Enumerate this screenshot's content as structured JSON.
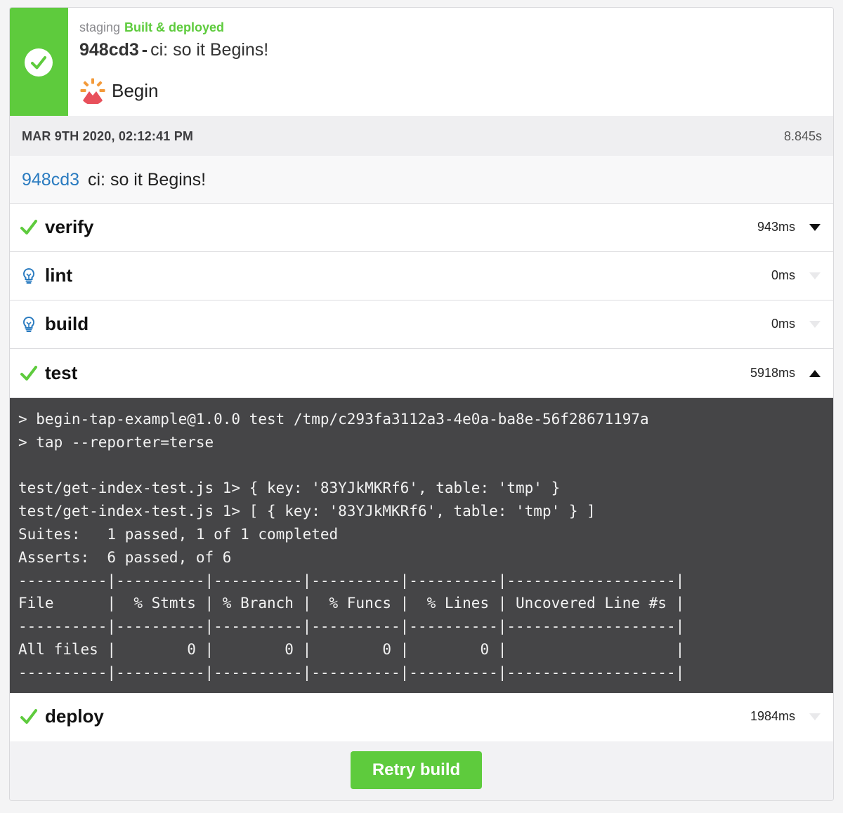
{
  "header": {
    "environment": "staging",
    "status_label": "Built & deployed",
    "commit_sha": "948cd3",
    "commit_separator": "-",
    "commit_message": "ci: so it Begins!",
    "app_name": "Begin",
    "status_color": "#5ecb3d"
  },
  "info": {
    "date": "MAR 9TH 2020, 02:12:41 PM",
    "duration": "8.845s"
  },
  "commit": {
    "sha": "948cd3",
    "message": "ci: so it Begins!"
  },
  "stages": [
    {
      "name": "verify",
      "duration": "943ms",
      "status": "passed",
      "icon": "checkmark-icon",
      "expanded": false
    },
    {
      "name": "lint",
      "duration": "0ms",
      "status": "skipped",
      "icon": "lightbulb-icon",
      "expanded": false
    },
    {
      "name": "build",
      "duration": "0ms",
      "status": "skipped",
      "icon": "lightbulb-icon",
      "expanded": false
    },
    {
      "name": "test",
      "duration": "5918ms",
      "status": "passed",
      "icon": "checkmark-icon",
      "expanded": true
    },
    {
      "name": "deploy",
      "duration": "1984ms",
      "status": "passed",
      "icon": "checkmark-icon",
      "expanded": false
    }
  ],
  "terminal": {
    "lines": [
      "> begin-tap-example@1.0.0 test /tmp/c293fa3112a3-4e0a-ba8e-56f28671197a",
      "> tap --reporter=terse",
      "",
      "test/get-index-test.js 1> { key: '83YJkMKRf6', table: 'tmp' }",
      "test/get-index-test.js 1> [ { key: '83YJkMKRf6', table: 'tmp' } ]",
      "Suites:   1 passed, 1 of 1 completed",
      "Asserts:  6 passed, of 6",
      "----------|----------|----------|----------|----------|-------------------|",
      "File      |  % Stmts | % Branch |  % Funcs |  % Lines | Uncovered Line #s |",
      "----------|----------|----------|----------|----------|-------------------|",
      "All files |        0 |        0 |        0 |        0 |                   |",
      "----------|----------|----------|----------|----------|-------------------|"
    ]
  },
  "footer": {
    "retry_label": "Retry build"
  },
  "colors": {
    "success": "#5ecb3d",
    "link": "#2a7bc0",
    "terminal_bg": "#454547"
  }
}
